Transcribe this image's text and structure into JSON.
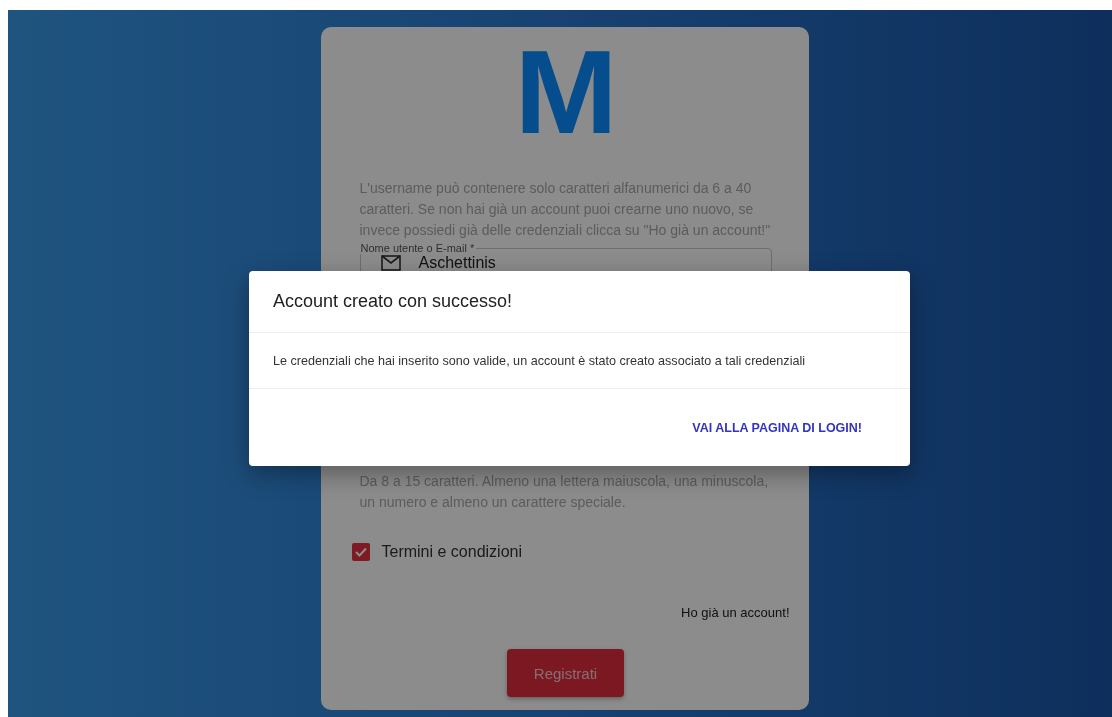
{
  "logo": {
    "text": "M"
  },
  "signup_form": {
    "intro": "L'username può contenere solo caratteri alfanumerici da 6 a 40 caratteri. Se non hai già un account puoi crearne uno nuovo, se invece possiedi già delle credenziali clicca su \"Ho già un account!\"",
    "username_field": {
      "label": "Nome utente o E-mail *",
      "value": "Aschettinis"
    },
    "password_hint": "Da 8 a 15 caratteri. Almeno una lettera maiuscola, una minuscola, un numero e almeno un carattere speciale.",
    "terms_checkbox": {
      "label": "Termini e condizioni",
      "checked": true
    },
    "login_link": "Ho già un account!",
    "register_button": "Registrati"
  },
  "dialog": {
    "title": "Account creato con successo!",
    "message": "Le credenziali che hai inserito sono valide, un account è stato creato associato a tali credenziali",
    "action": "VAI ALLA PAGINA DI LOGIN!"
  }
}
